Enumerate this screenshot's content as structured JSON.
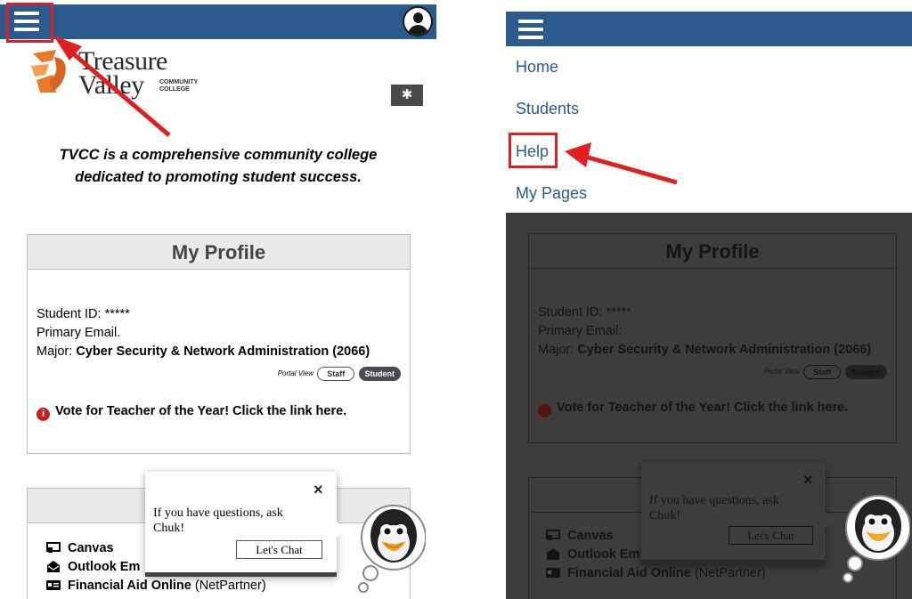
{
  "colors": {
    "topbar": "#2d5a8c",
    "menu_link": "#2d5a8c",
    "annotation_red": "#e02020",
    "logo_orange": "#e8782a",
    "overlay": "#3d3d3d"
  },
  "logo": {
    "line1": "Treasure",
    "line2": "Valley",
    "small_line1": "COMMUNITY",
    "small_line2": "COLLEGE"
  },
  "tagline": "TVCC is a comprehensive community college dedicated to promoting student success.",
  "profile": {
    "title": "My Profile",
    "student_id_label": "Student ID:",
    "student_id_value": "*****",
    "email_label": "Primary Email.",
    "email_label_right": "Primary Email:",
    "major_label": "Major:",
    "major_value": "Cyber Security & Network Administration (2066)",
    "portal_view_label": "Portal View",
    "staff_label": "Staff",
    "student_label": "Student",
    "vote_text": "Vote for Teacher of the Year! Click the link here."
  },
  "links": [
    {
      "label": "Canvas",
      "extra": ""
    },
    {
      "label": "Outlook Em",
      "extra": ""
    },
    {
      "label": "Financial Aid Online",
      "extra": " (NetPartner)"
    }
  ],
  "chat": {
    "text": "If you have questions, ask Chuk!",
    "button": "Let's Chat",
    "close": "×"
  },
  "menu": {
    "items": [
      "Home",
      "Students",
      "Help",
      "My Pages"
    ]
  }
}
